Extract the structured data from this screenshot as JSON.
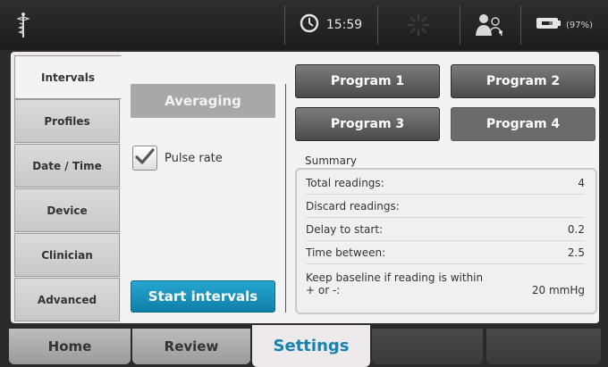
{
  "status_bar": {
    "time": "15:59",
    "battery_percent": "(97%)"
  },
  "side_tabs": [
    {
      "label": "Intervals",
      "active": true
    },
    {
      "label": "Profiles",
      "active": false
    },
    {
      "label": "Date / Time",
      "active": false
    },
    {
      "label": "Device",
      "active": false
    },
    {
      "label": "Clinician",
      "active": false
    },
    {
      "label": "Advanced",
      "active": false
    }
  ],
  "intervals": {
    "averaging_label": "Averaging",
    "pulse_rate_label": "Pulse rate",
    "pulse_rate_checked": true,
    "start_label": "Start intervals"
  },
  "programs": [
    "Program 1",
    "Program 2",
    "Program 3",
    "Program 4"
  ],
  "summary": {
    "title": "Summary",
    "rows": [
      {
        "label": "Total readings:",
        "value": "4"
      },
      {
        "label": "Discard readings:",
        "value": ""
      },
      {
        "label": "Delay to start:",
        "value": "0.2"
      },
      {
        "label": "Time between:",
        "value": "2.5"
      }
    ],
    "baseline_line1": "Keep baseline if reading is within",
    "baseline_line2": "+ or -:",
    "baseline_value": "20 mmHg"
  },
  "nav": {
    "home": "Home",
    "review": "Review",
    "settings": "Settings"
  },
  "colors": {
    "accent": "#1682ad",
    "start_button": "#1a92bf"
  }
}
